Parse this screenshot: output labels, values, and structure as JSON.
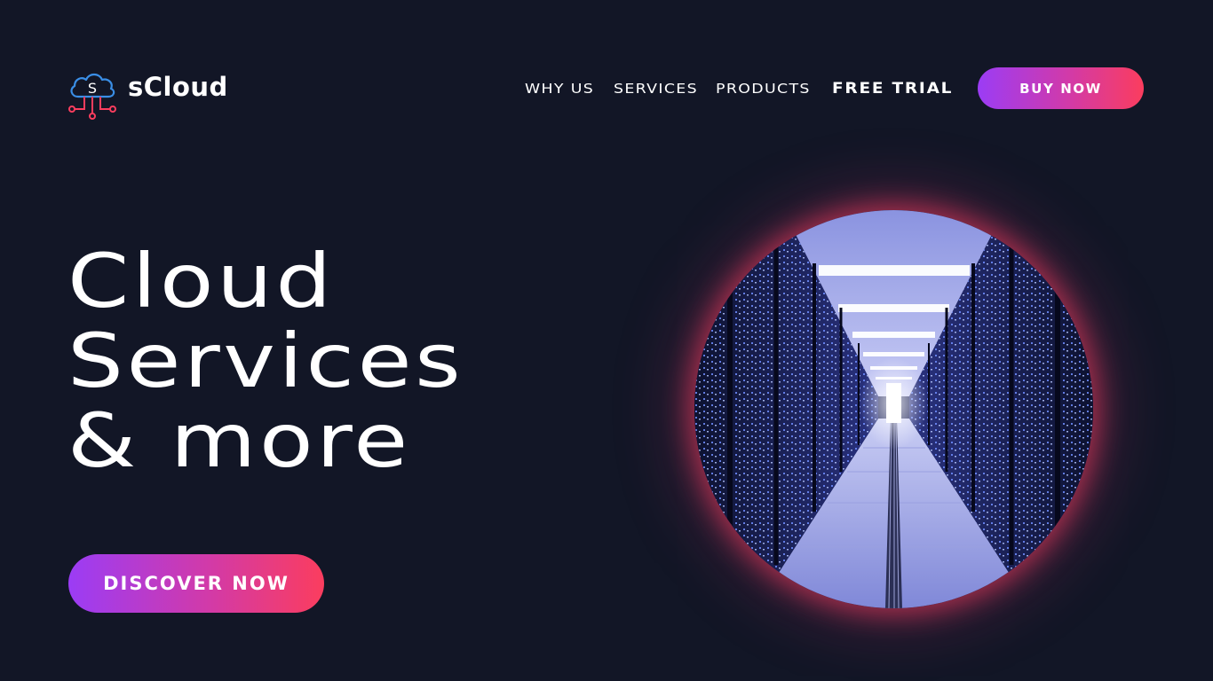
{
  "brand": {
    "name": "sCloud",
    "mark_letter": "S"
  },
  "nav": {
    "items": [
      {
        "label": "WHY US"
      },
      {
        "label": "SERVICES"
      },
      {
        "label": "PRODUCTS"
      },
      {
        "label": "FREE TRIAL"
      }
    ],
    "cta_label": "BUY NOW"
  },
  "hero": {
    "title_lines": [
      "Cloud",
      "Services",
      "& more"
    ],
    "cta_label": "DISCOVER NOW",
    "image_subject": "server-room-corridor"
  },
  "colors": {
    "background": "#121626",
    "gradient_start": "#9b3cf5",
    "gradient_end": "#fb3d5e",
    "logo_cloud": "#3a8ee6",
    "logo_circuit": "#fb3d5e"
  }
}
